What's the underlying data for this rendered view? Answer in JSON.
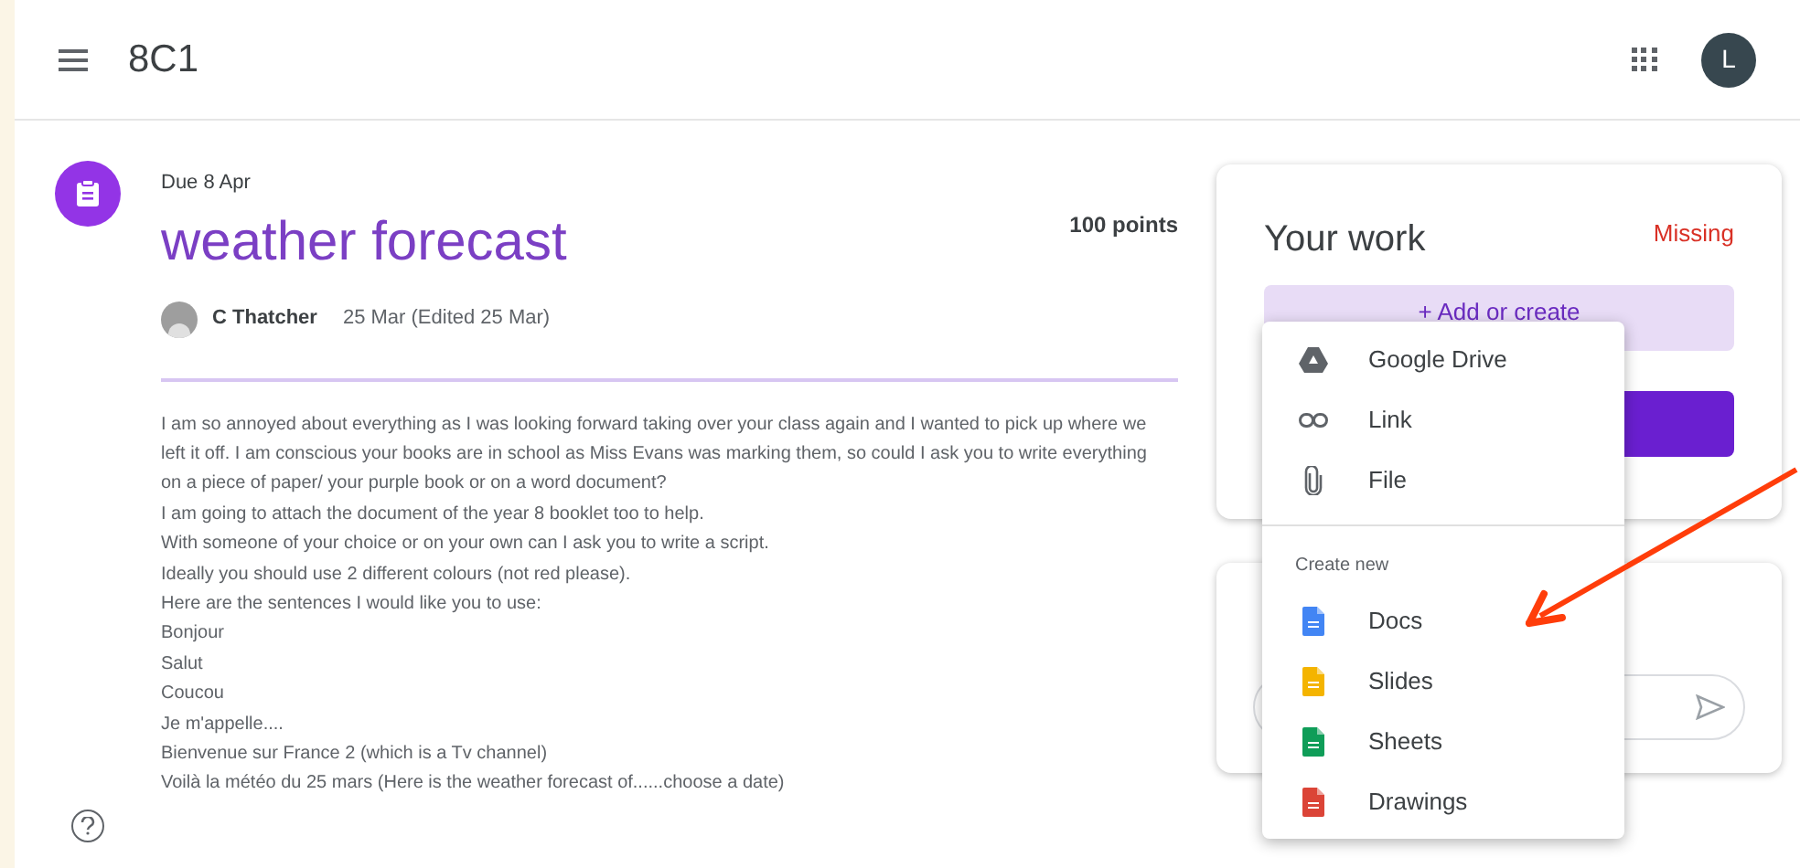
{
  "header": {
    "title": "8C1",
    "avatar_letter": "L"
  },
  "assignment": {
    "due": "Due 8 Apr",
    "title": "weather forecast",
    "points": "100 points",
    "author": "C Thatcher",
    "date": "25 Mar (Edited 25 Mar)",
    "body": [
      "I am so annoyed about everything as I was looking forward taking over your class again and I wanted to pick up where we left it off. I am conscious your books are in school as Miss Evans was marking them, so could I ask you to write everything on a piece of paper/ your purple book or on a word document?",
      "I am going to attach the document of the year 8 booklet too to help.",
      "With someone of your choice or on your own can I ask you to write a script.",
      "Ideally you should use 2 different colours (not red please).",
      "Here are the sentences I would like you to use:",
      "Bonjour",
      "Salut",
      "Coucou",
      "Je m'appelle....",
      "Bienvenue sur France 2 (which is a Tv channel)",
      "Voilà la météo du 25 mars (Here is the weather forecast of......choose a date)"
    ]
  },
  "your_work": {
    "title": "Your work",
    "status": "Missing",
    "add_button": "+ Add or create"
  },
  "add_menu": {
    "items": [
      {
        "kind": "drive",
        "label": "Google Drive"
      },
      {
        "kind": "link",
        "label": "Link"
      },
      {
        "kind": "file",
        "label": "File"
      }
    ],
    "section_title": "Create new",
    "create_items": [
      {
        "label": "Docs",
        "color": "#4285f4"
      },
      {
        "label": "Slides",
        "color": "#f4b400"
      },
      {
        "label": "Sheets",
        "color": "#0f9d58"
      },
      {
        "label": "Drawings",
        "color": "#db4437"
      }
    ]
  }
}
